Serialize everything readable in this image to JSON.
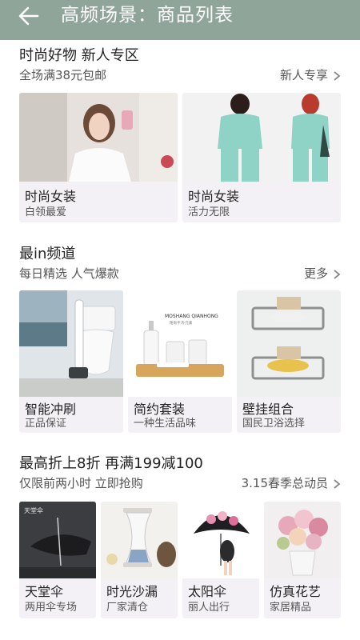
{
  "header": {
    "title": "高频场景：商品列表",
    "back_icon": "arrow-left-icon"
  },
  "section1": {
    "title": "时尚好物 新人专区",
    "subtitle": "全场满38元包邮",
    "more": "新人专享",
    "cards": [
      {
        "title": "时尚女装",
        "subtitle": "白领最爱",
        "image": "woman-white-blouse-photo"
      },
      {
        "title": "时尚女装",
        "subtitle": "活力无限",
        "image": "mint-tracksuit-photo"
      }
    ]
  },
  "section2": {
    "title": "最in频道",
    "subtitle": "每日精选 人气爆款",
    "more": "更多",
    "cards": [
      {
        "title": "智能冲刷",
        "subtitle": "正品保证",
        "image": "toilet-plunger-photo"
      },
      {
        "title": "简约套装",
        "subtitle": "一种生活品味",
        "image": "bath-set-photo",
        "image_text": [
          "MOSHANG QIANHONG",
          "陌尚千鸿·元素"
        ]
      },
      {
        "title": "壁挂组合",
        "subtitle": "国民卫浴选择",
        "image": "wall-soap-rack-photo"
      }
    ]
  },
  "section3": {
    "title": "最高折上8折 再满199减100",
    "subtitle": "仅限前两小时 立即抢购",
    "more": "3.15春季总动员",
    "cards": [
      {
        "title": "天堂伞",
        "subtitle": "两用伞专场",
        "image": "black-umbrella-photo",
        "image_text": "天堂伞"
      },
      {
        "title": "时光沙漏",
        "subtitle": "厂家清仓",
        "image": "hourglass-photo"
      },
      {
        "title": "太阳伞",
        "subtitle": "丽人出行",
        "image": "floral-parasol-photo"
      },
      {
        "title": "仿真花艺",
        "subtitle": "家居精品",
        "image": "artificial-flowers-photo"
      }
    ]
  },
  "colors": {
    "header_bg": "#8fa59a",
    "card_bg": "#f4f1f6",
    "text": "#222222",
    "subtext": "#555555"
  }
}
